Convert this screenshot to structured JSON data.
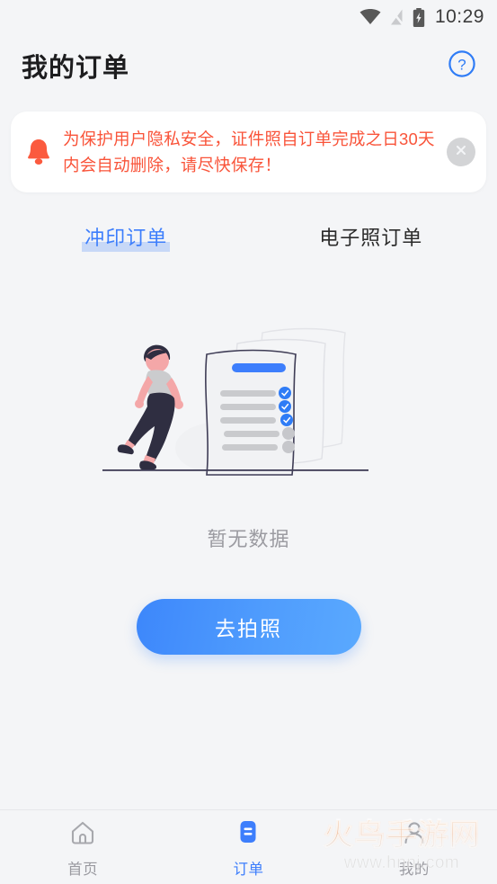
{
  "status_bar": {
    "time": "10:29",
    "icons": [
      "wifi-icon",
      "no-signal-icon",
      "battery-charging-icon"
    ]
  },
  "header": {
    "title": "我的订单",
    "help_icon": "question-circle-icon"
  },
  "notice": {
    "icon": "bell-icon",
    "text": "为保护用户隐私安全，证件照自订单完成之日30天内会自动删除，请尽快保存！",
    "close_icon": "close-circle-icon",
    "accent_color": "#f9543a"
  },
  "tabs": [
    {
      "label": "冲印订单",
      "active": true
    },
    {
      "label": "电子照订单",
      "active": false
    }
  ],
  "empty_state": {
    "illustration": "walking-person-with-checklist-documents",
    "text": "暂无数据"
  },
  "cta": {
    "label": "去拍照",
    "gradient_from": "#3d87fb",
    "gradient_to": "#5aa9fe"
  },
  "bottom_nav": [
    {
      "label": "首页",
      "icon": "home-icon",
      "active": false
    },
    {
      "label": "订单",
      "icon": "orders-icon",
      "active": true
    },
    {
      "label": "我的",
      "icon": "person-icon",
      "active": false
    }
  ],
  "watermark": {
    "main": "火鸟手游网",
    "sub": "www.hnnj.com"
  },
  "theme": {
    "background": "#f4f5f7",
    "accent_blue": "#3d7efc",
    "muted_text": "#9b9ba1"
  }
}
